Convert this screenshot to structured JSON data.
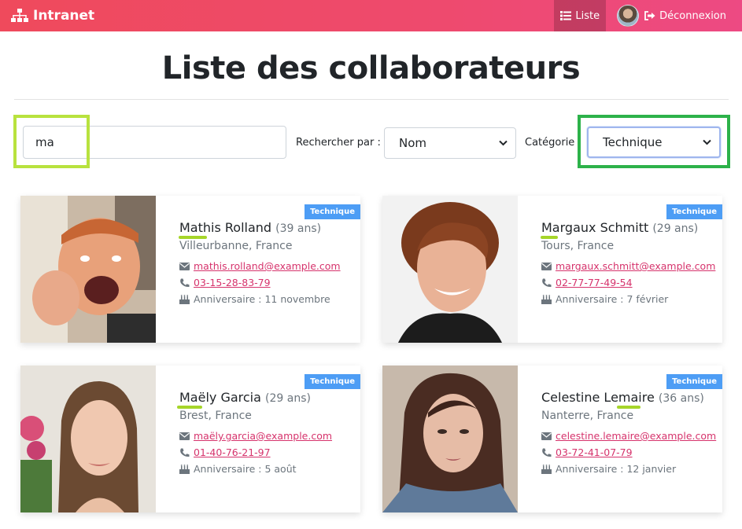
{
  "nav": {
    "brand": "Intranet",
    "list_label": "Liste",
    "logout_label": "Déconnexion"
  },
  "page": {
    "title": "Liste des collaborateurs"
  },
  "filters": {
    "search_value": "ma",
    "search_by_label": "Rechercher par :",
    "search_by_selected": "Nom",
    "category_label": "Catégorie :",
    "category_selected": "Technique"
  },
  "cards": [
    {
      "category": "Technique",
      "name": "Mathis Rolland",
      "age": "(39 ans)",
      "city": "Villeurbanne, France",
      "email": "mathis.rolland@example.com",
      "phone": "03-15-28-83-79",
      "birthday": "Anniversaire : 11 novembre"
    },
    {
      "category": "Technique",
      "name": "Margaux Schmitt",
      "age": "(29 ans)",
      "city": "Tours, France",
      "email": "margaux.schmitt@example.com",
      "phone": "02-77-77-49-54",
      "birthday": "Anniversaire : 7 février"
    },
    {
      "category": "Technique",
      "name": "Maëly Garcia",
      "age": "(29 ans)",
      "city": "Brest, France",
      "email": "maëly.garcia@example.com",
      "phone": "01-40-76-21-97",
      "birthday": "Anniversaire : 5 août"
    },
    {
      "category": "Technique",
      "name": "Celestine Lemaire",
      "age": "(36 ans)",
      "city": "Nanterre, France",
      "email": "celestine.lemaire@example.com",
      "phone": "03-72-41-07-79",
      "birthday": "Anniversaire : 12 janvier"
    }
  ],
  "colors": {
    "navbar": "#ee4a6e",
    "badge": "#4d9df5",
    "link": "#d6336c",
    "match_underline": "#a6d52a",
    "highlight_search": "#b8e23e",
    "highlight_category": "#2db24a"
  }
}
